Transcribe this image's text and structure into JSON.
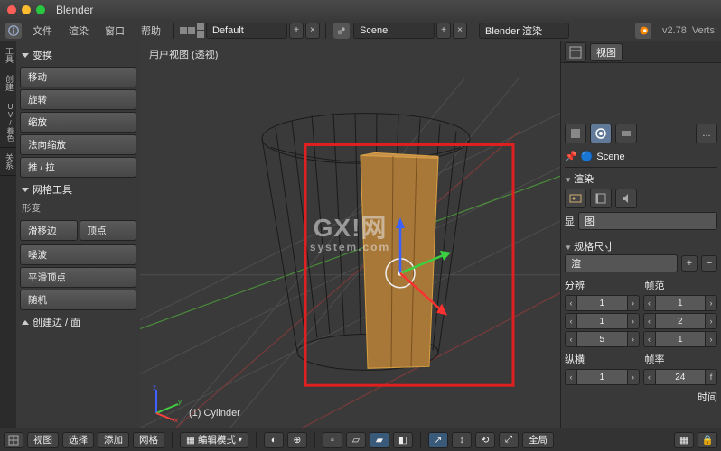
{
  "app": {
    "title": "Blender"
  },
  "menubar": {
    "file": "文件",
    "render": "渲染",
    "window": "窗口",
    "help": "帮助",
    "layout": "Default",
    "scene": "Scene",
    "engine": "Blender 渲染",
    "version": "v2.78",
    "stats": "Verts:"
  },
  "left": {
    "tabs": [
      "工具",
      "创建",
      "UV/着色",
      "关系"
    ],
    "transform_hdr": "变换",
    "move": "移动",
    "rotate": "旋转",
    "scale": "缩放",
    "normal_scale": "法向缩放",
    "push_pull": "推 / 拉",
    "meshtools_hdr": "网格工具",
    "deform_label": "形变:",
    "slide_edge": "滑移边",
    "vertex": "顶点",
    "noise": "噪波",
    "smooth_vertex": "平滑顶点",
    "random": "随机",
    "addedge_hdr": "创建边 / 面"
  },
  "viewport": {
    "label": "用户视图 (透视)",
    "objname": "(1) Cylinder",
    "watermark": "GX!网",
    "watermark_sub": "system.com"
  },
  "vpbar": {
    "view": "视图",
    "select": "选择",
    "add": "添加",
    "mesh": "网格",
    "mode": "编辑模式",
    "global": "全局"
  },
  "right": {
    "view_tab": "视图",
    "scene": "Scene",
    "render_hdr": "渲染",
    "display_label": "显",
    "image_label": "图",
    "size_hdr": "规格尺寸",
    "render_dd": "渲",
    "col_res": "分辨",
    "col_framerange": "帧范",
    "aspect": "纵横",
    "fps": "帧率",
    "fps_val": "24",
    "f_val": "f",
    "time": "时间"
  }
}
